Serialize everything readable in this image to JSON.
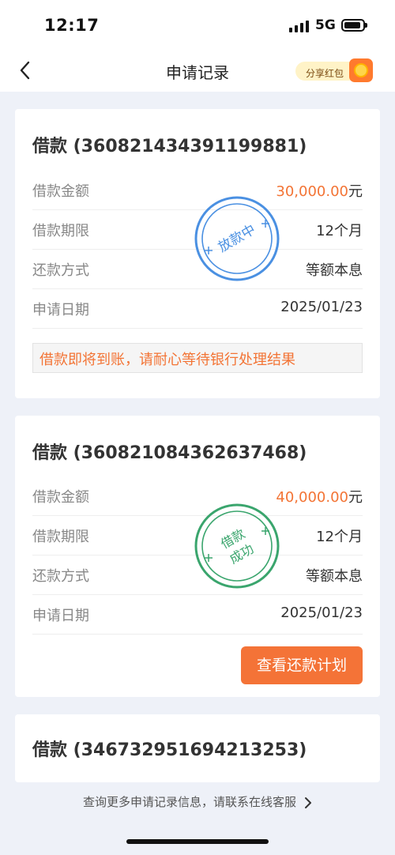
{
  "status_bar": {
    "time": "12:17",
    "network": "5G"
  },
  "nav": {
    "title": "申请记录",
    "share_label": "分享红包"
  },
  "records": [
    {
      "title": "借款 (360821434391199881)",
      "rows": [
        {
          "label": "借款金额",
          "amount": "30,000.00",
          "unit": "元"
        },
        {
          "label": "借款期限",
          "value": "12个月"
        },
        {
          "label": "还款方式",
          "value": "等额本息"
        },
        {
          "label": "申请日期",
          "value": "2025/01/23"
        }
      ],
      "stamp": {
        "text": "放款中",
        "color": "#4a90e2"
      },
      "notice": "借款即将到账，请耐心等待银行处理结果"
    },
    {
      "title": "借款 (360821084362637468)",
      "rows": [
        {
          "label": "借款金额",
          "amount": "40,000.00",
          "unit": "元"
        },
        {
          "label": "借款期限",
          "value": "12个月"
        },
        {
          "label": "还款方式",
          "value": "等额本息"
        },
        {
          "label": "申请日期",
          "value": "2025/01/23"
        }
      ],
      "stamp": {
        "line1": "借款",
        "line2": "成功",
        "color": "#3aa56d"
      },
      "button": "查看还款计划"
    },
    {
      "title": "借款 (346732951694213253)"
    }
  ],
  "footer": {
    "text": "查询更多申请记录信息，请联系在线客服"
  },
  "colors": {
    "accent": "#f37435",
    "background": "#eef1f8"
  }
}
